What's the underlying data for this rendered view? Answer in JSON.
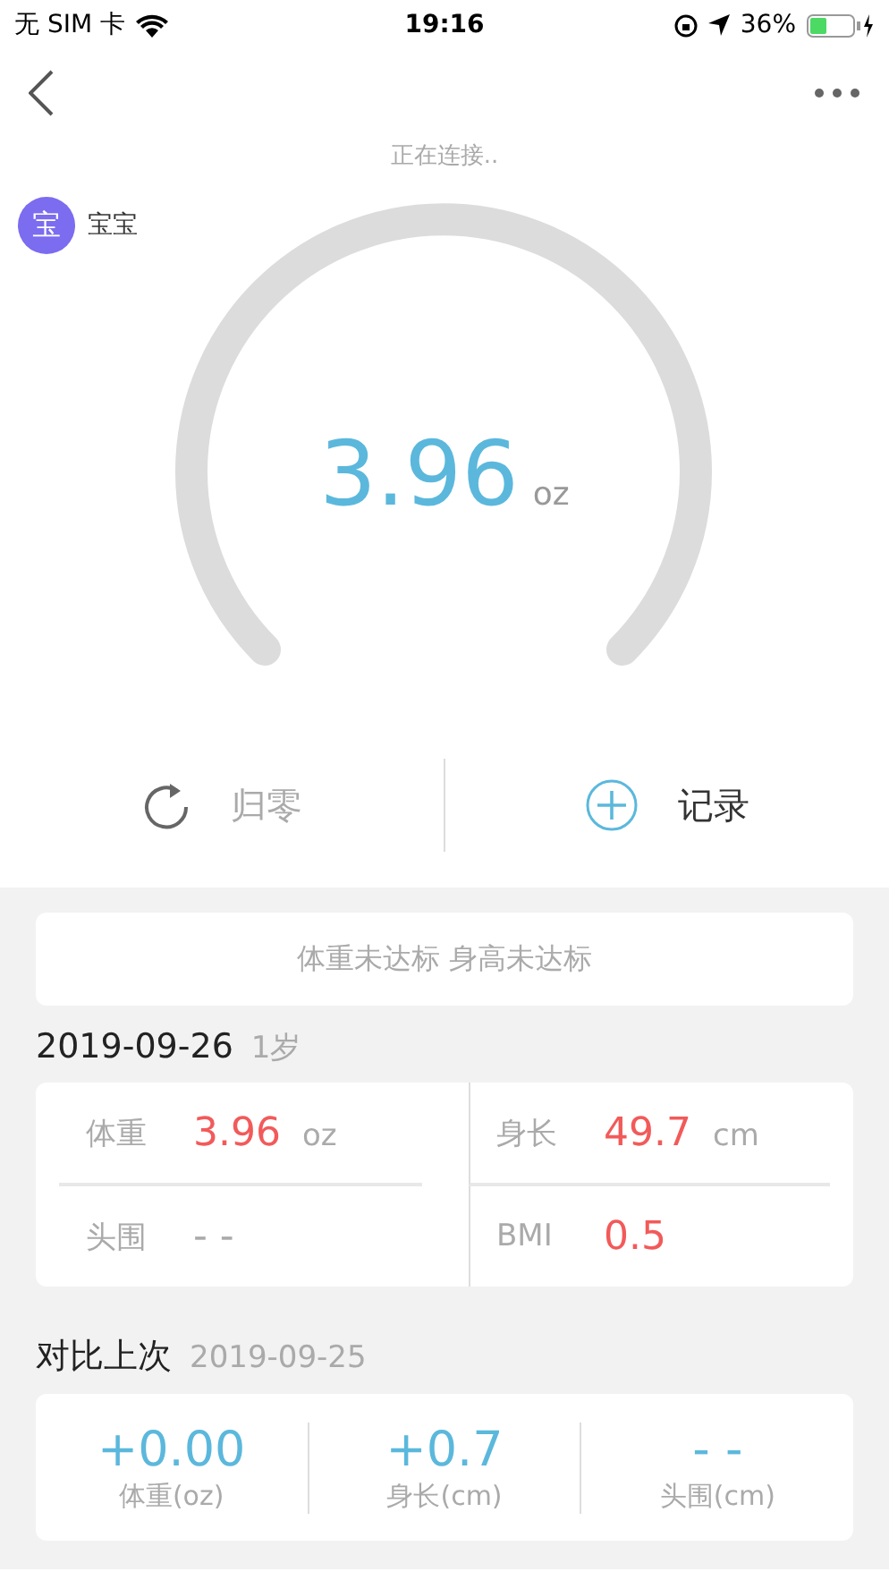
{
  "status_bar": {
    "carrier": "无 SIM 卡",
    "time": "19:16",
    "battery": "36%"
  },
  "connection": "正在连接..",
  "baby": {
    "avatar": "宝",
    "name": "宝宝"
  },
  "reading": {
    "value": "3.96",
    "unit": "oz"
  },
  "actions": [
    {
      "kind": "reset",
      "label": "归零"
    },
    {
      "kind": "add",
      "label": "记录"
    }
  ],
  "notice": "体重未达标 身高未达标",
  "record": {
    "date": "2019-09-26",
    "age": "1岁"
  },
  "metrics": [
    {
      "label": "体重",
      "value": "3.96",
      "unit": "oz",
      "flagged": true
    },
    {
      "label": "身长",
      "value": "49.7",
      "unit": "cm",
      "flagged": true
    },
    {
      "label": "头围",
      "value": "- -",
      "flagged": false
    },
    {
      "label": "BMI",
      "value": "0.5",
      "flagged": true
    }
  ],
  "compare": {
    "title": "对比上次",
    "date": "2019-09-25",
    "items": [
      {
        "value": "+0.00",
        "label": "体重(oz)"
      },
      {
        "value": "+0.7",
        "label": "身长(cm)"
      },
      {
        "value": "- -",
        "label": "头围(cm)"
      }
    ]
  }
}
